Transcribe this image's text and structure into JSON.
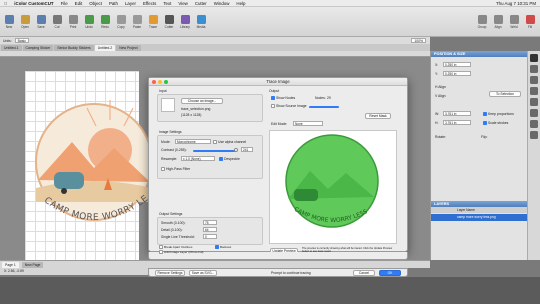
{
  "menubar": {
    "app": "iColor CustomCUT",
    "items": [
      "File",
      "Edit",
      "Object",
      "Path",
      "Layer",
      "Effects",
      "Text",
      "View",
      "Cutter",
      "Window",
      "Help"
    ],
    "window_title": "iColor CustomCUT - Untitled-2",
    "clock": "Thu Aug 7  10:31 PM"
  },
  "toolbar": {
    "items": [
      "New",
      "Open",
      "Save",
      "Cut",
      "Print",
      "Undo",
      "Redo",
      "Copy",
      "Paste",
      "Trace",
      "Cutter",
      "Library",
      "Media",
      "Group",
      "Align",
      "Weld",
      "Fill"
    ]
  },
  "subbar": {
    "units": "Units:",
    "unit_value": "Basic",
    "zoom": "100%"
  },
  "tabs": [
    "Untitled-1",
    "Camping Sticker",
    "Senior Buddy Stickers",
    "Untitled-2",
    "New Project"
  ],
  "dialog": {
    "title": "Trace Image",
    "input": {
      "label": "Input",
      "choose_button": "Choose an image...",
      "filename": "trace_selection.png",
      "dims": "(1128 x 1128)"
    },
    "settings": {
      "label": "Image Settings",
      "mode_label": "Mode:",
      "mode_value": "Monochrome",
      "alpha_label": "Use alpha channel",
      "contrast_label": "Contrast (0-255):",
      "contrast_value": "241",
      "resample_label": "Resample:",
      "resample_value": "x 1.0 (None)",
      "despeckle_label": "Despeckle",
      "highpass_label": "High-Pass Filter"
    },
    "output": {
      "label": "Output Settings",
      "smooth_label": "Smooth (0-100):",
      "smooth_value": "75",
      "detail_label": "Detail (0-100):",
      "detail_value": "64",
      "threshold_label": "Single Line Threshold:",
      "threshold_value": "0",
      "break_label": "Break Apart Outlines",
      "backout_label": "Backout",
      "addimage_label": "Add Image Layer (Print+Cut)"
    },
    "output_right": {
      "label": "Output",
      "show_nodes": "Show Nodes",
      "nodes_label": "Nodes:",
      "nodes_value": "29",
      "show_source": "Show Source Image",
      "reset_mask": "Reset Mask",
      "edit_mode_label": "Edit Mode:",
      "edit_mode_value": "None"
    },
    "preview_button": "Update Preview",
    "preview_note": "The preview is currently showing what will be traced. Click the Update Preview button to see trace result.",
    "remove_button": "Remove Settings",
    "save_svg": "Save as SVG...",
    "prompt": "Prompt to continue tracing",
    "cancel": "Cancel",
    "ok": "OK",
    "art_text": "CAMP MORE WORRY LESS"
  },
  "canvas_art_text": "CAMP MORE WORRY LESS",
  "right_panel": {
    "position_header": "POSITION & SIZE",
    "x_label": "X:",
    "x_value": "0.250 in",
    "y_label": "Y:",
    "y_value": "0.250 in",
    "halign": "H Align",
    "valign": "V Align",
    "to_selection": "To Selection",
    "w_label": "W:",
    "w_value": "3.761 in",
    "h_label": "H:",
    "h_value": "3.761 in",
    "keep_proportions": "Keep proportions",
    "scale_strokes": "Scale strokes",
    "rotate_label": "Rotate:",
    "flip_label": "Flip:",
    "layers_header": "LAYERS",
    "layer_name_col": "Layer Name",
    "layer_item": "camp more worry less.png"
  },
  "status": {
    "page": "Page 1",
    "new_page": "New Page",
    "coords": "X: 2.86, -0.89"
  },
  "colors": {
    "accent": "#2f7cf6",
    "panel_header": "#5d8ac6",
    "trace_green": "#5fc95a"
  }
}
